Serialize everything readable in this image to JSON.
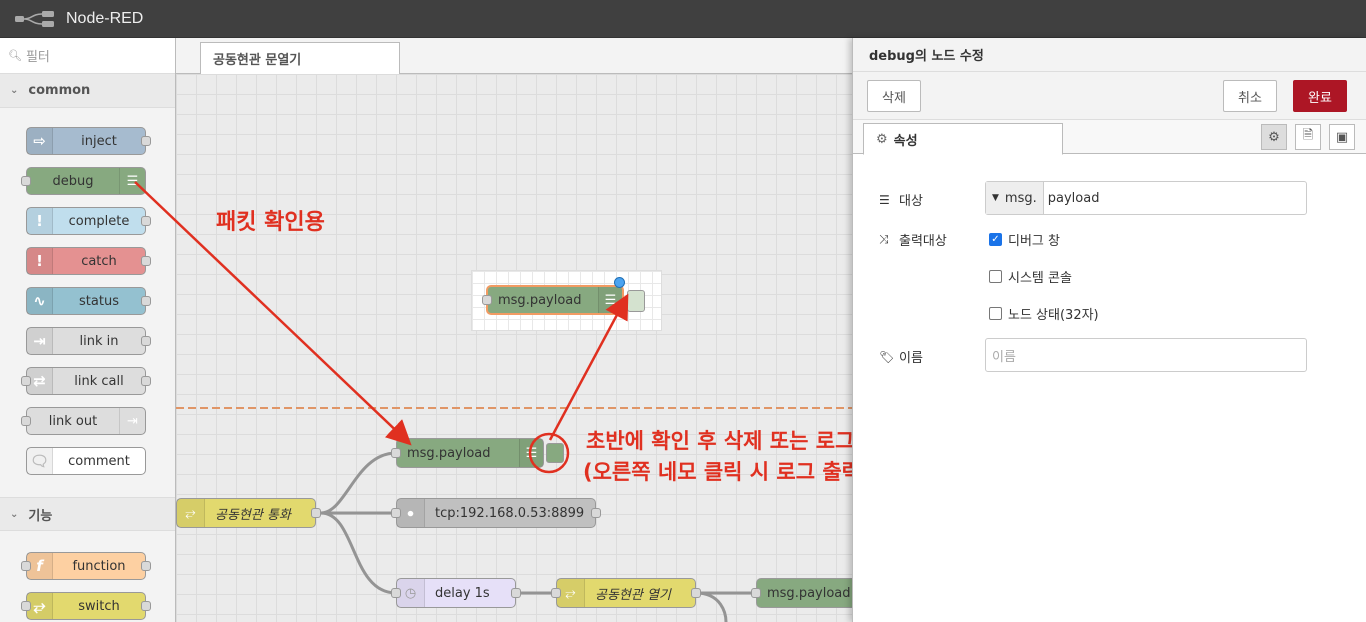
{
  "app": {
    "title": "Node-RED"
  },
  "palette": {
    "filter_placeholder": "필터",
    "categories": [
      {
        "label": "common",
        "nodes": [
          "inject",
          "debug",
          "complete",
          "catch",
          "status",
          "link in",
          "link call",
          "link out",
          "comment"
        ]
      },
      {
        "label": "기능",
        "nodes": [
          "function",
          "switch"
        ]
      }
    ]
  },
  "workspace": {
    "tab": "공동현관 문열기",
    "nodes": {
      "preview_debug": "msg.payload",
      "debug1": "msg.payload",
      "call": "공동현관 통화",
      "tcp": "tcp:192.168.0.53:8899",
      "delay": "delay 1s",
      "open": "공동현관 열기",
      "debug2": "msg.payload"
    }
  },
  "annotations": {
    "packet": "패킷 확인용",
    "line1": "초반에 확인 후 삭제 또는 로그 출력되지 않도록 비활성화",
    "line2": "(오른쪽 네모 클릭 시 로그 출력하지 않음)"
  },
  "tray": {
    "title": "debug의 노드 수정",
    "delete_label": "삭제",
    "cancel_label": "취소",
    "done_label": "완료",
    "properties_tab": "속성",
    "target_label": "대상",
    "target_prefix": "msg.",
    "target_value": "payload",
    "output_label": "출력대상",
    "options": [
      {
        "label": "디버그 창",
        "checked": true
      },
      {
        "label": "시스템 콘솔",
        "checked": false
      },
      {
        "label": "노드 상태(32자)",
        "checked": false
      }
    ],
    "name_label": "이름",
    "name_placeholder": "이름"
  },
  "colors": {
    "accent": "#ad1625",
    "annotation": "#e03020",
    "debug": "#87a980",
    "inject": "#a6bbcf",
    "complete": "#c0deed",
    "catch": "#e49191",
    "function": "#fdd0a2",
    "switch": "#e2d96e",
    "tcp": "#c0c0c0"
  }
}
